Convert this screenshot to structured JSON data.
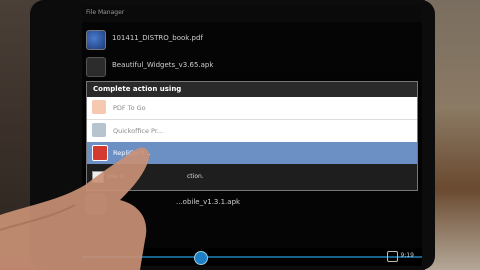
{
  "app": {
    "title": "File Manager"
  },
  "files": [
    {
      "name": "101411_DISTRO_book.pdf",
      "icon": "pdf-icon"
    },
    {
      "name": "Beautiful_Widgets_v3.65.apk",
      "icon": "apk-icon"
    },
    {
      "name": "...obile_v1.3.1.apk",
      "icon": "apk-icon"
    }
  ],
  "dialog": {
    "title": "Complete action using",
    "options": [
      {
        "label": "PDF To Go",
        "icon": "pdf-to-go-icon",
        "selected": false
      },
      {
        "label": "Quickoffice Pr...",
        "icon": "quickoffice-icon",
        "selected": false
      },
      {
        "label": "RepliGo R...",
        "icon": "repligo-icon",
        "selected": true
      }
    ],
    "default_checkbox_label": "Use b",
    "default_checkbox_label_tail": "ction."
  },
  "systembar": {
    "time": "9:19"
  },
  "colors": {
    "highlight": "#6c8fc4",
    "systembar_accent": "#19608a"
  }
}
